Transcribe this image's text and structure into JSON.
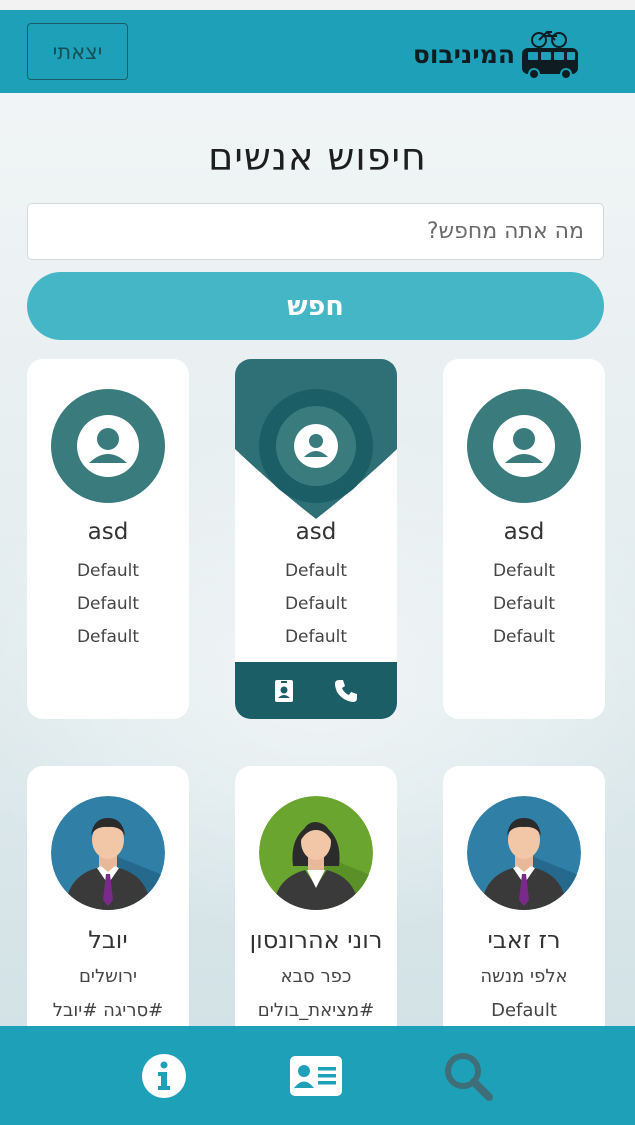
{
  "header": {
    "logo_text": "המיניבוס",
    "logout_label": "יצאתי"
  },
  "search": {
    "title": "חיפוש אנשים",
    "placeholder": "מה אתה מחפש?",
    "button_label": "חפש"
  },
  "cards_row1": [
    {
      "name": "asd",
      "line1": "Default",
      "line2": "Default",
      "line3": "Default"
    },
    {
      "name": "asd",
      "line1": "Default",
      "line2": "Default",
      "line3": "Default"
    },
    {
      "name": "asd",
      "line1": "Default",
      "line2": "Default",
      "line3": "Default"
    }
  ],
  "cards_row2": [
    {
      "name": "יובל",
      "city": "ירושלים",
      "tags": "#סריגה #יובל"
    },
    {
      "name": "רוני אהרונסון",
      "city": "כפר סבא",
      "tags": "#מציאת_בולים"
    },
    {
      "name": "רז זאבי",
      "city": "אלפי מנשה",
      "tags": "Default"
    }
  ],
  "colors": {
    "primary": "#1ea0b8",
    "button": "#44b6c6",
    "dark_teal": "#1b5e66",
    "avatar_teal": "#3a7c7e"
  },
  "icons": {
    "info": "info-icon",
    "contact": "contact-card-icon",
    "search": "search-icon",
    "phone": "phone-icon",
    "badge": "id-badge-icon"
  }
}
